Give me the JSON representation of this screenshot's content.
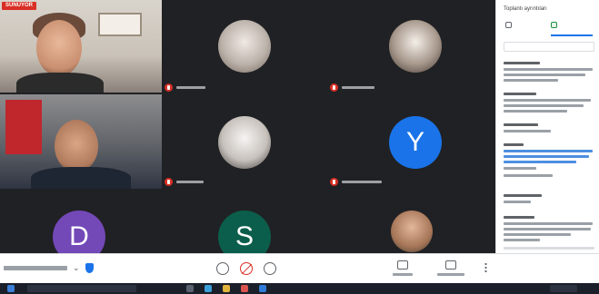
{
  "grid": {
    "presenting_badge": "SUNUYOR",
    "letter_avatars": {
      "y": "Y",
      "d": "D",
      "s": "S"
    },
    "colors": {
      "y": "#1a73e8",
      "d": "#7348b7",
      "s": "#0b5e4b",
      "muted_badge": "#d93025",
      "background": "#202124"
    }
  },
  "panel": {
    "title": "Toplantı ayrıntıları",
    "tabs": [
      {
        "icon": "people-icon"
      },
      {
        "icon": "chat-icon"
      }
    ]
  },
  "controls": {
    "icons": [
      "chevron-down-icon",
      "shield-icon",
      "mic-icon",
      "camera-off-icon",
      "present-screen-icon",
      "captions-icon",
      "present-now-icon",
      "more-options-icon"
    ]
  }
}
